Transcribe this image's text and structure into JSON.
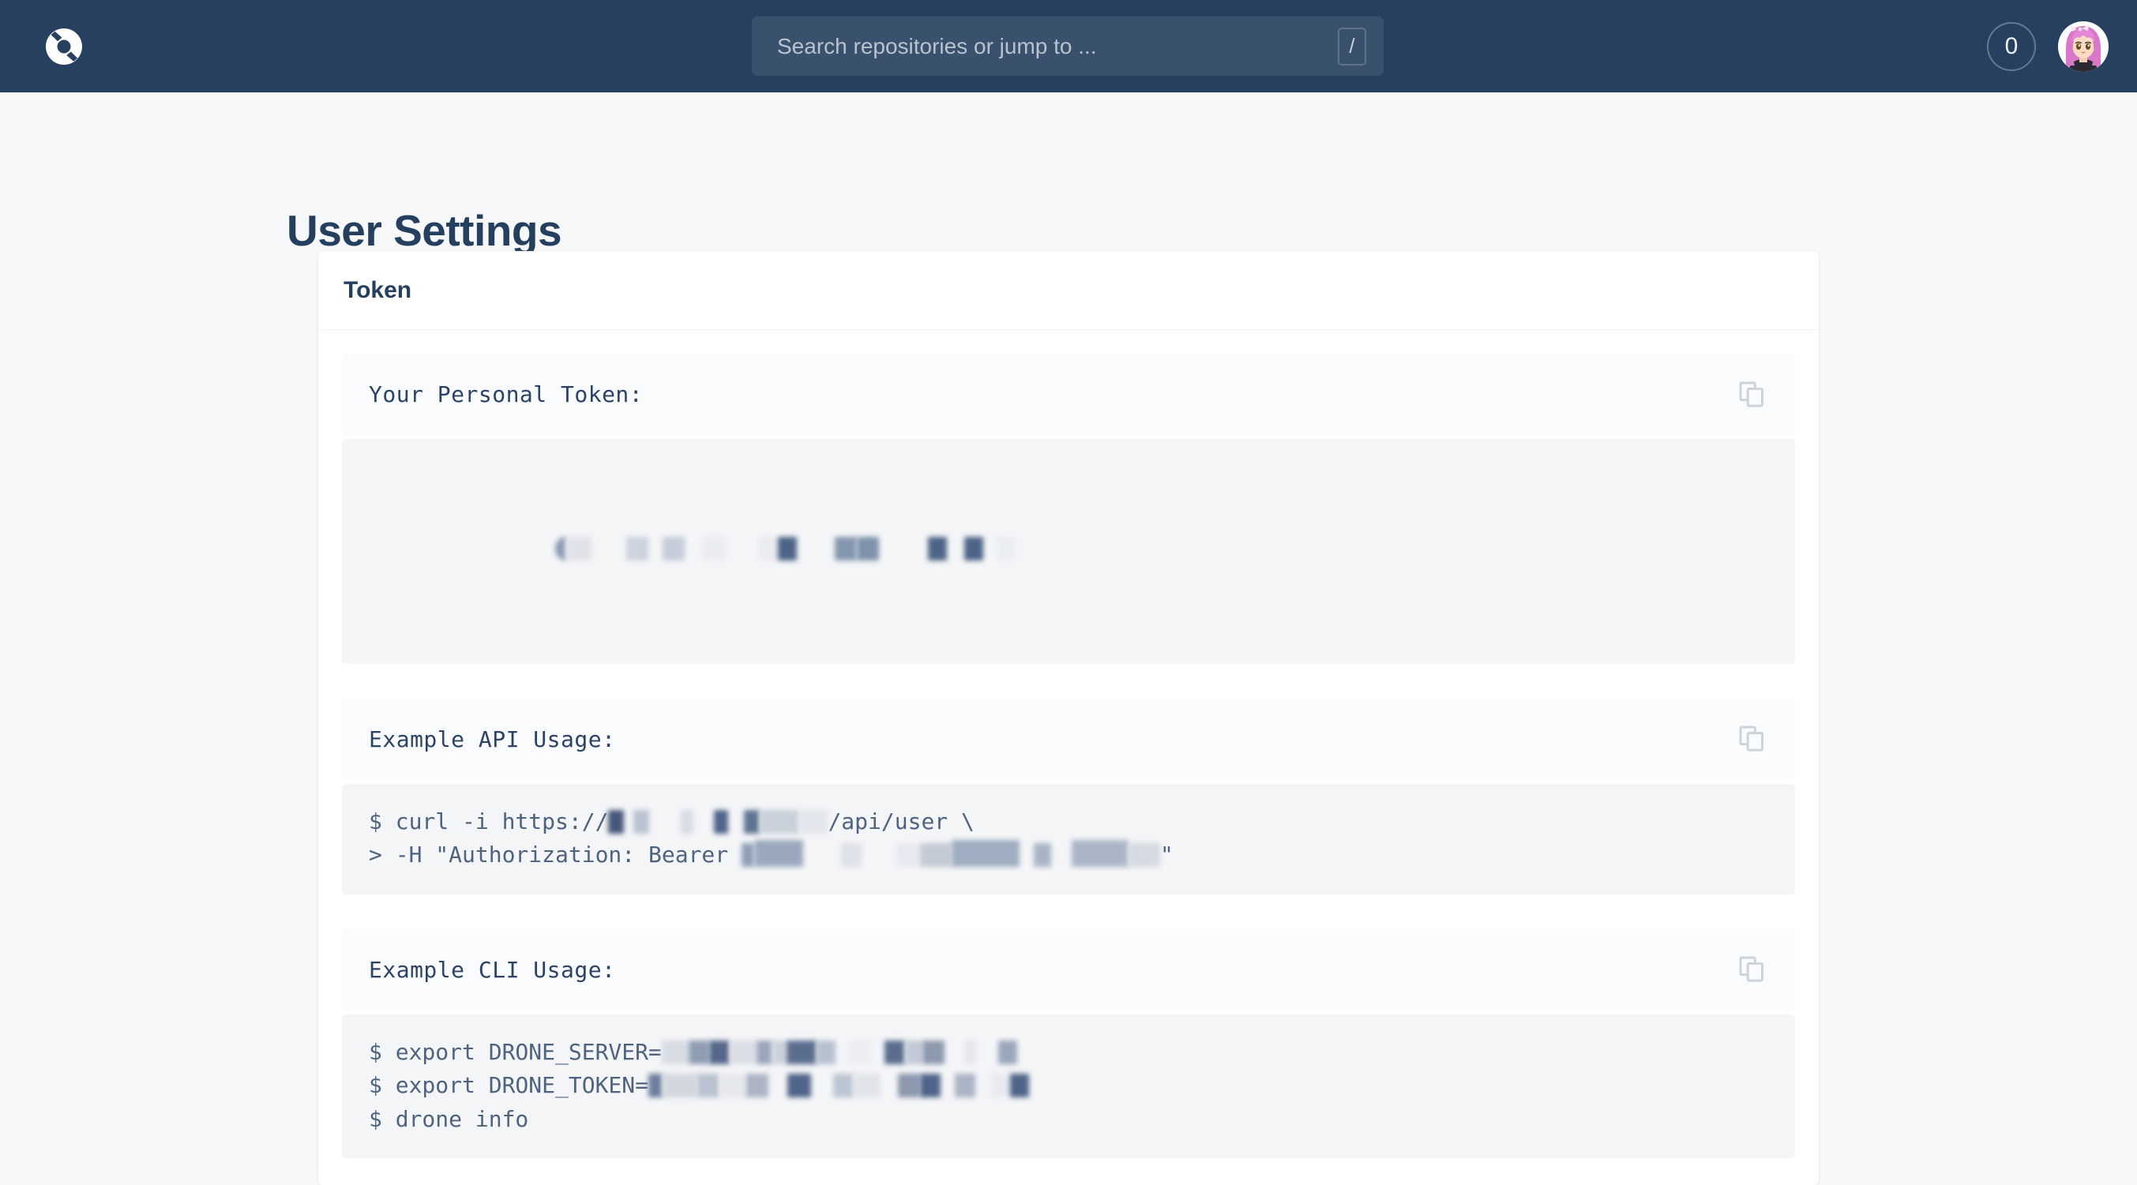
{
  "topbar": {
    "logo_icon": "drone-logo-icon",
    "search": {
      "placeholder": "Search repositories or jump to ...",
      "value": "",
      "shortcut_key": "/"
    },
    "notification_count": "0",
    "avatar_alt": "user-avatar"
  },
  "page": {
    "title": "User Settings"
  },
  "card": {
    "title": "Token",
    "sections": [
      {
        "label": "Your Personal Token:",
        "copy_icon": "copy-icon",
        "code": "",
        "redacted": true
      },
      {
        "label": "Example API Usage:",
        "copy_icon": "copy-icon",
        "code_line_1_prefix": "$ curl -i https://",
        "code_line_1_suffix": "/api/user \\",
        "code_line_2_prefix": "> -H \"Authorization: Bearer ",
        "code_line_2_suffix": "\"",
        "redacted": true
      },
      {
        "label": "Example CLI Usage:",
        "copy_icon": "copy-icon",
        "code_line_1_prefix": "$ export DRONE_SERVER=",
        "code_line_2_prefix": "$ export DRONE_TOKEN=",
        "code_line_3": "$ drone info",
        "redacted": true
      }
    ]
  },
  "colors": {
    "header_bg": "#27405f",
    "page_bg": "#f6f8fa",
    "card_bg": "#ffffff",
    "panel_bg": "#fafbfc",
    "code_bg": "#f3f5f7",
    "text_dark": "#25405f",
    "code_text": "#4e637f",
    "icon_gray": "#ccd3dd"
  }
}
